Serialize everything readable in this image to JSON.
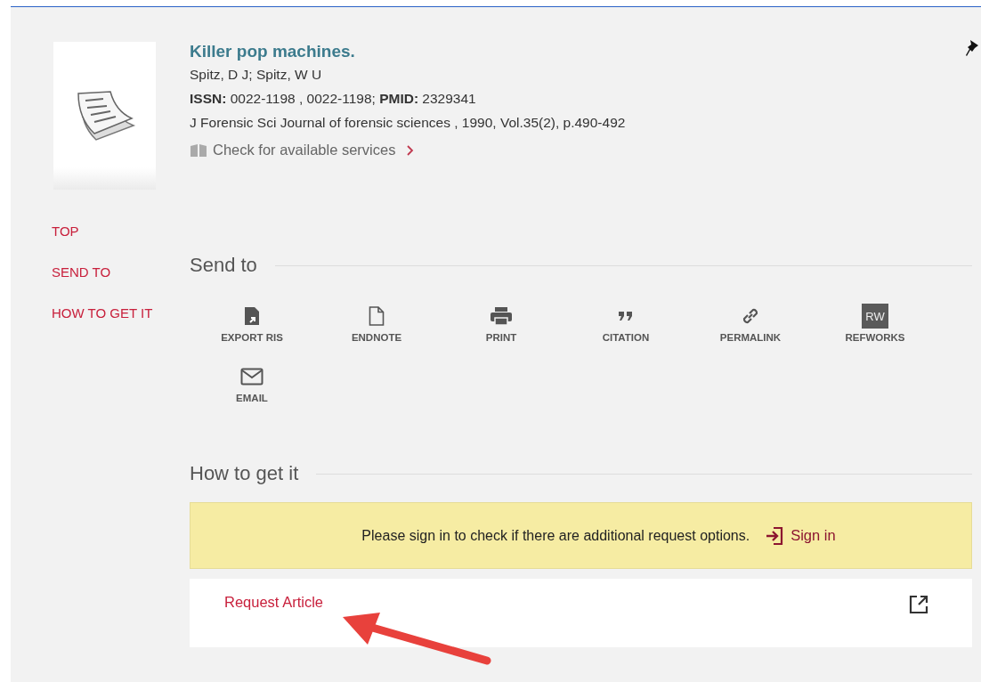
{
  "record": {
    "title": "Killer pop machines.",
    "authors": "Spitz, D J; Spitz, W U",
    "identifiers": "**ISSN:** 0022-1198 , 0022-1198; **PMID:** 2329341",
    "source": "J Forensic Sci Journal of forensic sciences , 1990, Vol.35(2), p.490-492",
    "services_link": "Check for available services"
  },
  "nav": [
    {
      "label": "TOP"
    },
    {
      "label": "SEND TO"
    },
    {
      "label": "HOW TO GET IT"
    }
  ],
  "send_to": {
    "heading": "Send to",
    "actions": [
      {
        "label": "EXPORT RIS",
        "kind": "export"
      },
      {
        "label": "ENDNOTE",
        "kind": "file"
      },
      {
        "label": "PRINT",
        "kind": "print"
      },
      {
        "label": "CITATION",
        "kind": "quote"
      },
      {
        "label": "PERMALINK",
        "kind": "link"
      },
      {
        "label": "REFWORKS",
        "kind": "badge",
        "badge": "RW"
      },
      {
        "label": "EMAIL",
        "kind": "mail"
      }
    ]
  },
  "how_to_get": {
    "heading": "How to get it",
    "notice": "Please sign in to check if there are additional request options.",
    "sign_in": "Sign in",
    "request_link": "Request Article"
  }
}
